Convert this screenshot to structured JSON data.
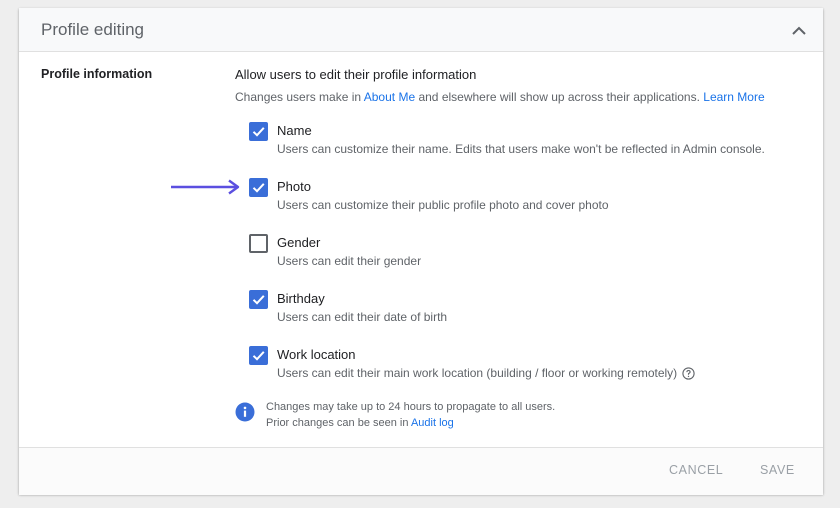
{
  "header": {
    "title": "Profile editing",
    "collapse_icon": "chevron-up-icon"
  },
  "section": {
    "label": "Profile information",
    "title": "Allow users to edit their profile information",
    "desc_before": "Changes users make in ",
    "desc_link": "About Me",
    "desc_after": " and elsewhere will show up across their applications. ",
    "learn_more": "Learn More"
  },
  "options": [
    {
      "label": "Name",
      "desc": "Users can customize their name. Edits that users make won't be reflected in Admin console.",
      "checked": true
    },
    {
      "label": "Photo",
      "desc": "Users can customize their public profile photo and cover photo",
      "checked": true
    },
    {
      "label": "Gender",
      "desc": "Users can edit their gender",
      "checked": false
    },
    {
      "label": "Birthday",
      "desc": "Users can edit their date of birth",
      "checked": true
    },
    {
      "label": "Work location",
      "desc": "Users can edit their main work location (building / floor or working remotely)",
      "checked": true
    }
  ],
  "info": {
    "line1": "Changes may take up to 24 hours to propagate to all users.",
    "line2_before": "Prior changes can be seen in ",
    "line2_link": "Audit log"
  },
  "footer": {
    "cancel": "CANCEL",
    "save": "SAVE"
  },
  "colors": {
    "accent": "#3a6ed8",
    "link": "#1a73e8",
    "arrow": "#5b4fe0"
  }
}
